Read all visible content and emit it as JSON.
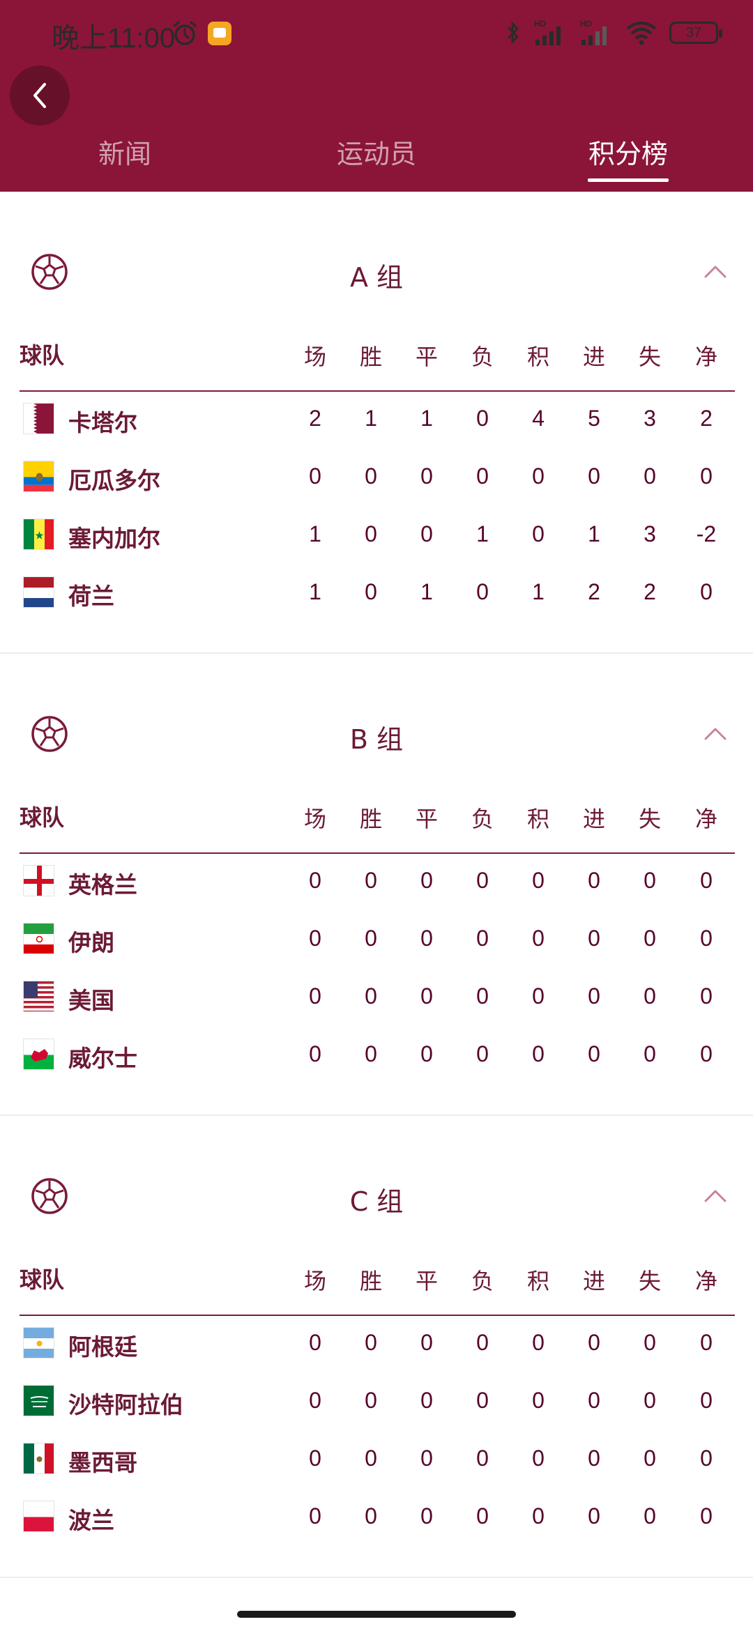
{
  "status_bar": {
    "time": "晚上11:00",
    "battery": "37"
  },
  "tabs": [
    {
      "label": "新闻",
      "active": false
    },
    {
      "label": "运动员",
      "active": false
    },
    {
      "label": "积分榜",
      "active": true
    }
  ],
  "columns": {
    "team": "球队",
    "stats": [
      "场",
      "胜",
      "平",
      "负",
      "积",
      "进",
      "失",
      "净"
    ]
  },
  "groups": [
    {
      "title": "A 组",
      "teams": [
        {
          "name": "卡塔尔",
          "flag": "qatar-flag",
          "stats": [
            "2",
            "1",
            "1",
            "0",
            "4",
            "5",
            "3",
            "2"
          ]
        },
        {
          "name": "厄瓜多尔",
          "flag": "ecuador-flag",
          "stats": [
            "0",
            "0",
            "0",
            "0",
            "0",
            "0",
            "0",
            "0"
          ]
        },
        {
          "name": "塞内加尔",
          "flag": "senegal-flag",
          "stats": [
            "1",
            "0",
            "0",
            "1",
            "0",
            "1",
            "3",
            "-2"
          ]
        },
        {
          "name": "荷兰",
          "flag": "netherlands-flag",
          "stats": [
            "1",
            "0",
            "1",
            "0",
            "1",
            "2",
            "2",
            "0"
          ]
        }
      ]
    },
    {
      "title": "B 组",
      "teams": [
        {
          "name": "英格兰",
          "flag": "england-flag",
          "stats": [
            "0",
            "0",
            "0",
            "0",
            "0",
            "0",
            "0",
            "0"
          ]
        },
        {
          "name": "伊朗",
          "flag": "iran-flag",
          "stats": [
            "0",
            "0",
            "0",
            "0",
            "0",
            "0",
            "0",
            "0"
          ]
        },
        {
          "name": "美国",
          "flag": "usa-flag",
          "stats": [
            "0",
            "0",
            "0",
            "0",
            "0",
            "0",
            "0",
            "0"
          ]
        },
        {
          "name": "威尔士",
          "flag": "wales-flag",
          "stats": [
            "0",
            "0",
            "0",
            "0",
            "0",
            "0",
            "0",
            "0"
          ]
        }
      ]
    },
    {
      "title": "C 组",
      "teams": [
        {
          "name": "阿根廷",
          "flag": "argentina-flag",
          "stats": [
            "0",
            "0",
            "0",
            "0",
            "0",
            "0",
            "0",
            "0"
          ]
        },
        {
          "name": "沙特阿拉伯",
          "flag": "saudi-arabia-flag",
          "stats": [
            "0",
            "0",
            "0",
            "0",
            "0",
            "0",
            "0",
            "0"
          ]
        },
        {
          "name": "墨西哥",
          "flag": "mexico-flag",
          "stats": [
            "0",
            "0",
            "0",
            "0",
            "0",
            "0",
            "0",
            "0"
          ]
        },
        {
          "name": "波兰",
          "flag": "poland-flag",
          "stats": [
            "0",
            "0",
            "0",
            "0",
            "0",
            "0",
            "0",
            "0"
          ]
        }
      ]
    }
  ],
  "colors": {
    "brand": "#8A1538",
    "text": "#56042C"
  }
}
